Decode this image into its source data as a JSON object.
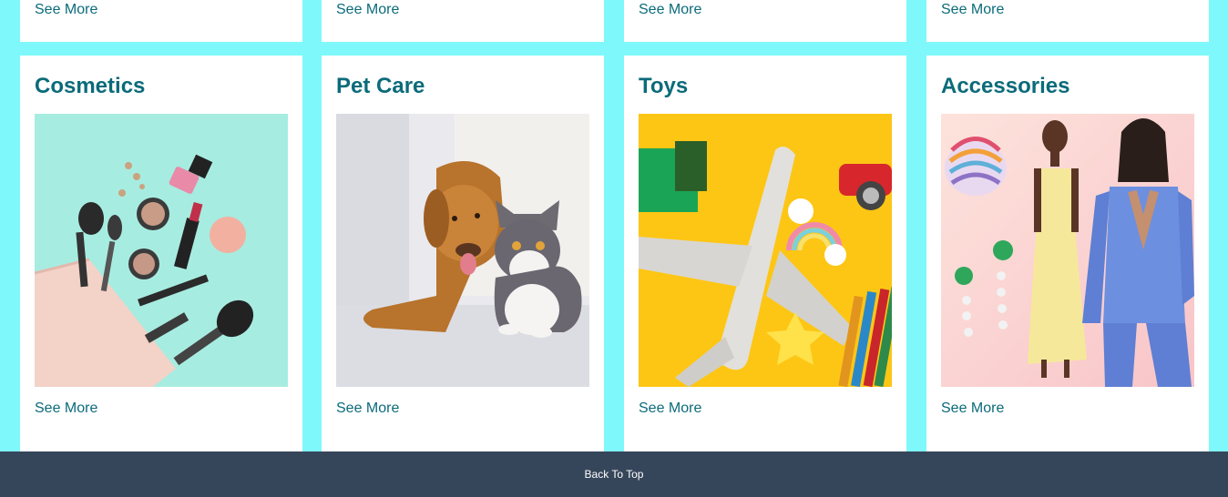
{
  "top_row": {
    "see_more_labels": [
      "See More",
      "See More",
      "See More",
      "See More"
    ]
  },
  "categories": [
    {
      "title": "Cosmetics",
      "link": "See More",
      "image": "cosmetics-image"
    },
    {
      "title": "Pet Care",
      "link": "See More",
      "image": "pet-care-image"
    },
    {
      "title": "Toys",
      "link": "See More",
      "image": "toys-image"
    },
    {
      "title": "Accessories",
      "link": "See More",
      "image": "accessories-image"
    }
  ],
  "footer": {
    "back_to_top": "Back To Top"
  },
  "colors": {
    "page_background": "#7ef8fa",
    "card_background": "#ffffff",
    "title_color": "#0b6b7a",
    "footer_background": "#36465a"
  }
}
